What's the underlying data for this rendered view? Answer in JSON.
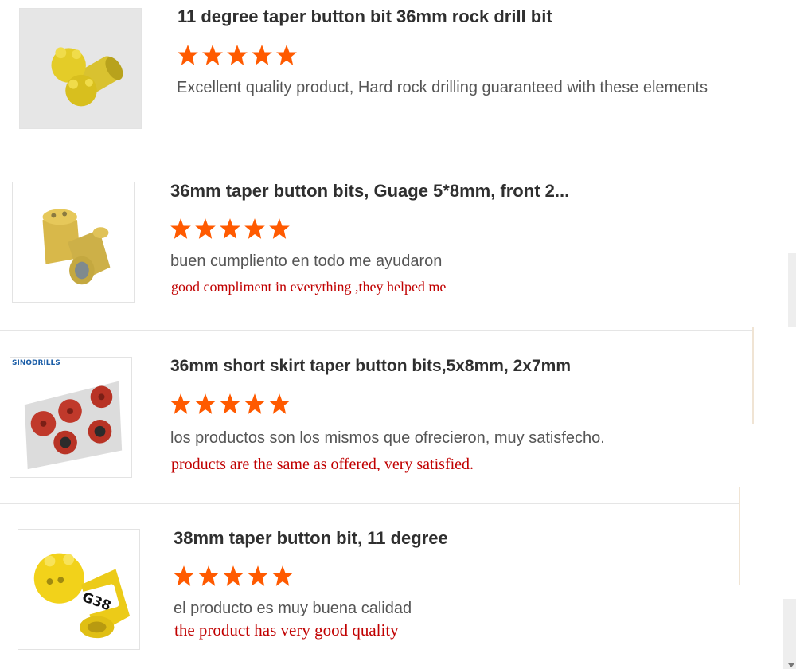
{
  "reviews": [
    {
      "title": "11 degree taper button bit 36mm rock drill bit",
      "rating": 5,
      "comment": "Excellent quality product, Hard rock drilling guaranteed with these elements",
      "translation": ""
    },
    {
      "title": "36mm taper button bits, Guage 5*8mm, front 2...",
      "rating": 5,
      "comment": "buen cumpliento en todo me ayudaron",
      "translation": "good compliment in everything ,they helped me"
    },
    {
      "title": "36mm short skirt taper button bits,5x8mm, 2x7mm",
      "rating": 5,
      "comment": "los productos son los mismos que ofrecieron, muy satisfecho.",
      "translation": "products are the same as offered, very satisfied.",
      "image_brand": "SINODRILLS"
    },
    {
      "title": "38mm taper button bit, 11 degree",
      "rating": 5,
      "comment": "el producto es muy buena calidad",
      "translation": "the product has very good quality",
      "image_label": "G38"
    }
  ],
  "colors": {
    "star": "#ff5a00",
    "translation": "#c00000",
    "title": "#2f2f2f",
    "comment": "#555555"
  }
}
